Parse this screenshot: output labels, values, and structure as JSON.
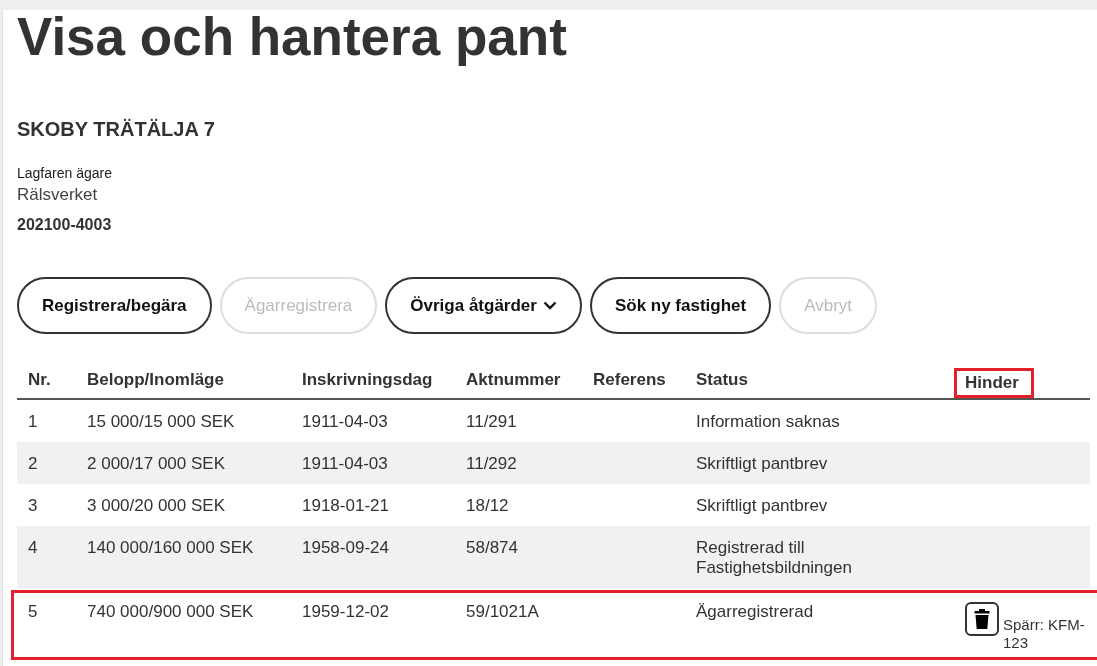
{
  "page": {
    "title": "Visa och hantera pant"
  },
  "property": {
    "name": "SKOBY TRÄTÄLJA 7",
    "owner_label": "Lagfaren ägare",
    "owner_name": "Rälsverket",
    "owner_id": "202100-4003"
  },
  "buttons": [
    {
      "label": "Registrera/begära",
      "disabled": false,
      "kind": "plain"
    },
    {
      "label": "Ägarregistrera",
      "disabled": true,
      "kind": "plain"
    },
    {
      "label": "Övriga åtgärder",
      "disabled": false,
      "kind": "dropdown"
    },
    {
      "label": "Sök ny fastighet",
      "disabled": false,
      "kind": "plain"
    },
    {
      "label": "Avbryt",
      "disabled": true,
      "kind": "plain"
    }
  ],
  "table": {
    "columns": [
      {
        "label": "Nr.",
        "highlighted": false
      },
      {
        "label": "Belopp/Inomläge",
        "highlighted": false
      },
      {
        "label": "Inskrivningsdag",
        "highlighted": false
      },
      {
        "label": "Aktnummer",
        "highlighted": false
      },
      {
        "label": "Referens",
        "highlighted": false
      },
      {
        "label": "Status",
        "highlighted": false
      },
      {
        "label": "Hinder",
        "highlighted": true
      }
    ],
    "rows": [
      {
        "nr": "1",
        "amount": "15 000/15 000 SEK",
        "date": "1911-04-03",
        "act": "11/291",
        "status": "Information saknas",
        "highlighted": false
      },
      {
        "nr": "2",
        "amount": "2 000/17 000 SEK",
        "date": "1911-04-03",
        "act": "11/292",
        "status": "Skriftligt pantbrev",
        "highlighted": false
      },
      {
        "nr": "3",
        "amount": "3 000/20 000 SEK",
        "date": "1918-01-21",
        "act": "18/12",
        "status": "Skriftligt pantbrev",
        "highlighted": false
      },
      {
        "nr": "4",
        "amount": "140 000/160 000 SEK",
        "date": "1958-09-24",
        "act": "58/874",
        "status": "Registrerad till Fastighetsbildningen",
        "highlighted": false
      },
      {
        "nr": "5",
        "amount": "740 000/900 000 SEK",
        "date": "1959-12-02",
        "act": "59/1021A",
        "status": "Ägarregistrerad",
        "highlighted": true,
        "hinder": {
          "text": "Spärr: KFM-123"
        }
      }
    ]
  }
}
